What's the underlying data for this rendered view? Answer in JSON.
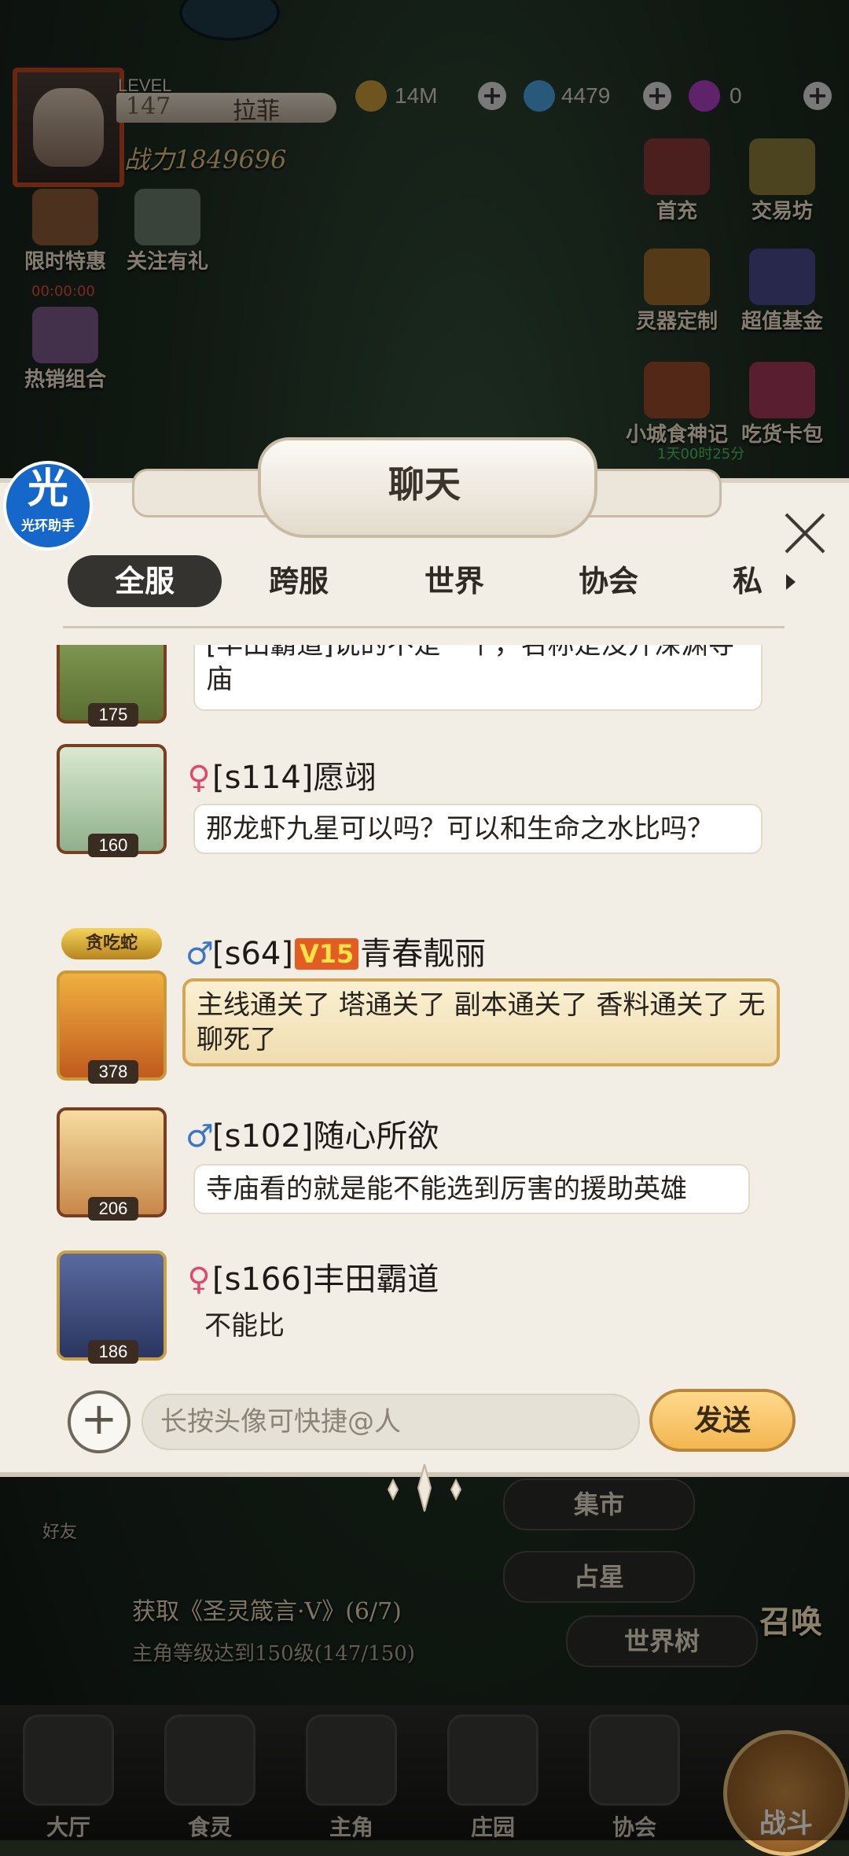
{
  "hud": {
    "level_label": "LEVEL",
    "level": "147",
    "player_name": "拉菲",
    "power": "战力1849696",
    "gold": "14M",
    "crystals": "4479",
    "gems": "0"
  },
  "side_left": [
    {
      "label": "限时特惠"
    },
    {
      "label": "关注有礼"
    },
    {
      "label": "热销组合"
    }
  ],
  "side_right": [
    {
      "label": "首充"
    },
    {
      "label": "交易坊"
    },
    {
      "label": "灵器定制"
    },
    {
      "label": "超值基金"
    },
    {
      "label": "小城食神记"
    },
    {
      "label": "吃货卡包"
    }
  ],
  "timers": {
    "left": "00:00:00",
    "right": "1天00时25分"
  },
  "helper": {
    "big": "光",
    "small": "光环助手"
  },
  "chat": {
    "title": "聊天",
    "tabs": [
      "全服",
      "跨服",
      "世界",
      "协会",
      "私聊"
    ],
    "messages": [
      {
        "sender": "",
        "level": "175",
        "text": "[丰田霸道]说的不是一个，名称是没开深渊寺庙"
      },
      {
        "gender": "♀",
        "sender": "[s114]愿翊",
        "level": "160",
        "text": "那龙虾九星可以吗？可以和生命之水比吗？"
      },
      {
        "gender": "♂",
        "sender_pre": "[s64]",
        "vip": "V15",
        "sender_post": "青春靓丽",
        "level": "378",
        "badge": "贪吃蛇",
        "text": "主线通关了 塔通关了  副本通关了  香料通关了 无聊死了"
      },
      {
        "gender": "♂",
        "sender": "[s102]随心所欲",
        "level": "206",
        "text": "寺庙看的就是能不能选到厉害的援助英雄"
      },
      {
        "gender": "♀",
        "sender": "[s166]丰田霸道",
        "level": "186",
        "text": "不能比"
      }
    ],
    "input_placeholder": "长按头像可快捷@人",
    "send_label": "发送"
  },
  "bottom_area": {
    "friends": "好友",
    "market": "集市",
    "astrology": "占星",
    "world_tree": "世界树",
    "summon": "召唤",
    "quest_title": "获取《圣灵箴言·V》(6/7)",
    "quest_sub": "主角等级达到150级(147/150)"
  },
  "nav": [
    "大厅",
    "食灵",
    "主角",
    "庄园",
    "协会"
  ],
  "battle_label": "战斗"
}
